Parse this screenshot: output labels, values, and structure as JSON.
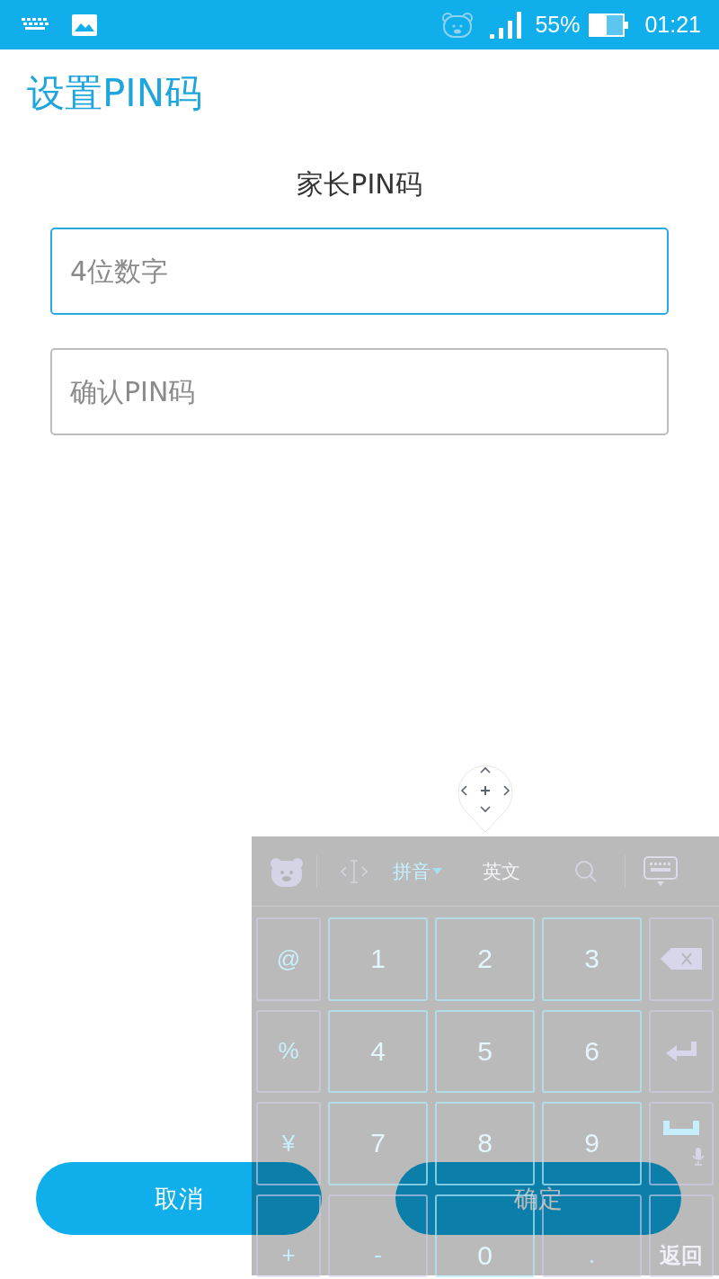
{
  "status_bar": {
    "battery_text": "55%",
    "time": "01:21"
  },
  "title": "设置PIN码",
  "section_label": "家长PIN码",
  "fields": [
    {
      "placeholder": "4位数字",
      "focused": true
    },
    {
      "placeholder": "确认PIN码",
      "focused": false
    }
  ],
  "buttons": [
    "取消",
    "确定"
  ],
  "keyboard": {
    "modes": [
      {
        "label": "拼音",
        "selected": true
      },
      {
        "label": "英文",
        "selected": false
      }
    ],
    "rows": [
      [
        {
          "kind": "symbol",
          "label": "@"
        },
        {
          "kind": "digit",
          "label": "1"
        },
        {
          "kind": "digit",
          "label": "2"
        },
        {
          "kind": "digit",
          "label": "3"
        },
        {
          "kind": "backspace"
        }
      ],
      [
        {
          "kind": "symbol",
          "label": "%"
        },
        {
          "kind": "digit",
          "label": "4"
        },
        {
          "kind": "digit",
          "label": "5"
        },
        {
          "kind": "digit",
          "label": "6"
        },
        {
          "kind": "enter"
        }
      ],
      [
        {
          "kind": "symbol",
          "label": "¥"
        },
        {
          "kind": "digit",
          "label": "7"
        },
        {
          "kind": "digit",
          "label": "8"
        },
        {
          "kind": "digit",
          "label": "9"
        },
        {
          "kind": "space"
        }
      ],
      [
        {
          "kind": "symbol",
          "label": "+"
        },
        {
          "kind": "symbol",
          "label": "-"
        },
        {
          "kind": "digit",
          "label": "0"
        },
        {
          "kind": "symbol",
          "label": "."
        },
        {
          "kind": "word",
          "label": "返回"
        }
      ]
    ]
  }
}
